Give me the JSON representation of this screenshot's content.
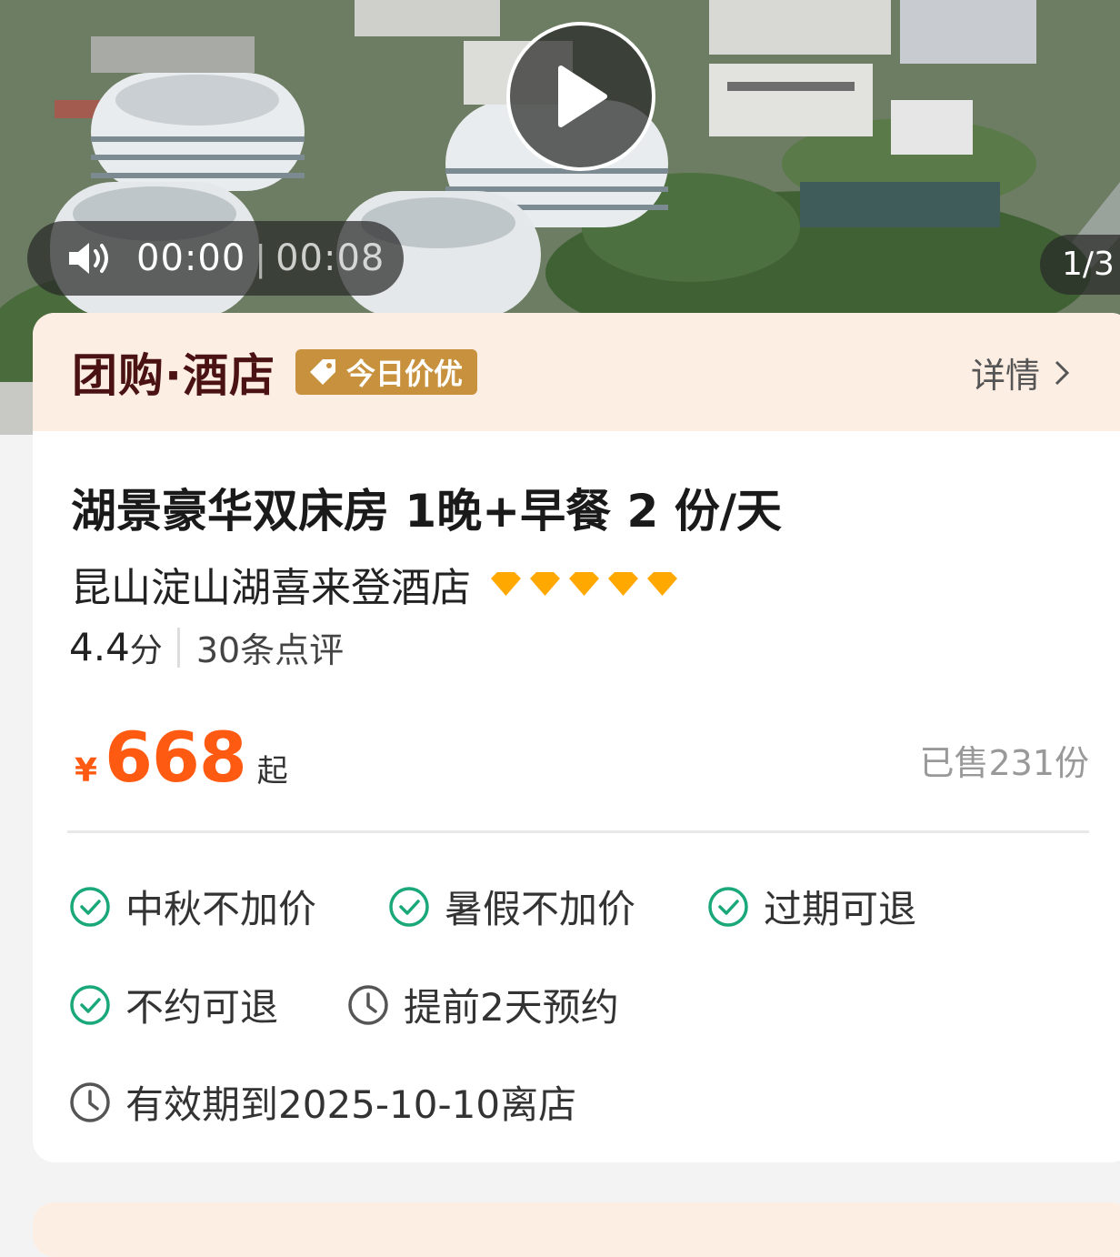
{
  "media": {
    "current_time": "00:00",
    "duration": "00:08",
    "page_indicator": "1/3",
    "icons": {
      "play": "play-icon",
      "volume": "volume-icon"
    }
  },
  "header": {
    "brand": "团购·酒店",
    "deal_tag": "今日价优",
    "detail_link": "详情"
  },
  "product": {
    "title": "湖景豪华双床房 1晚+早餐 2 份/天",
    "hotel_name": "昆山淀山湖喜来登酒店",
    "diamond_rating": 5,
    "score": "4.4",
    "score_unit": "分",
    "reviews": "30条点评",
    "currency": "¥",
    "price": "668",
    "price_suffix": "起",
    "sold": "已售231份"
  },
  "tags": [
    {
      "label": "中秋不加价",
      "icon": "check-circle-icon"
    },
    {
      "label": "暑假不加价",
      "icon": "check-circle-icon"
    },
    {
      "label": "过期可退",
      "icon": "check-circle-icon"
    },
    {
      "label": "不约可退",
      "icon": "check-circle-icon"
    },
    {
      "label": "提前2天预约",
      "icon": "clock-icon"
    },
    {
      "label": "有效期到2025-10-10离店",
      "icon": "clock-icon"
    }
  ],
  "colors": {
    "accent_price": "#ff5a12",
    "brand_text": "#4a1212",
    "header_bg": "#fdeee4",
    "deal_tag_bg": "#c8913d",
    "check_green": "#1aa87a",
    "diamond": "#ffa800"
  }
}
